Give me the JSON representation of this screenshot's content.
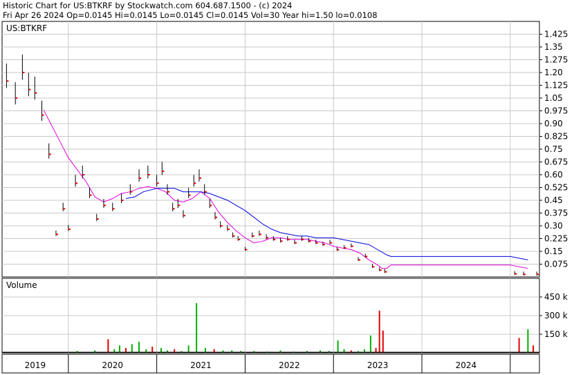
{
  "header": {
    "line1": "Historic Chart for US:BTKRF by Stockwatch.com 604.687.1500 - (c) 2024",
    "line2": "Fri Apr 26 2024   Op=0.0145   Hi=0.0145   Lo=0.0145   Cl=0.0145   Vol=30   Year hi=1.50   lo=0.0108"
  },
  "chart_data": [
    {
      "type": "line",
      "panel_label": "US:BTKRF",
      "ylim": [
        0,
        1.5
      ],
      "y_ticks": [
        0.075,
        0.15,
        0.225,
        0.3,
        0.375,
        0.45,
        0.525,
        0.6,
        0.675,
        0.75,
        0.825,
        0.9,
        0.975,
        1.05,
        1.125,
        1.2,
        1.275,
        1.35,
        1.425
      ],
      "y_tick_labels": [
        "0.075",
        "0.15",
        "0.225",
        "0.30",
        "0.375",
        "0.45",
        "0.525",
        "0.60",
        "0.675",
        "0.75",
        "0.825",
        "0.90",
        "0.975",
        "1.05",
        "1.125",
        "1.20",
        "1.275",
        "1.35",
        "1.425"
      ],
      "x_ticks": [
        "2019",
        "2020",
        "2021",
        "2022",
        "2023",
        "2024"
      ],
      "grid": true,
      "series": [
        {
          "kind": "price",
          "x": [
            2018.3,
            2018.4,
            2018.48,
            2018.55,
            2018.62,
            2018.7,
            2018.78,
            2018.86,
            2018.94,
            2019.0,
            2019.08,
            2019.16,
            2019.24,
            2019.32,
            2019.4,
            2019.5,
            2019.6,
            2019.7,
            2019.8,
            2019.9,
            2020.0,
            2020.06,
            2020.12,
            2020.18,
            2020.24,
            2020.3,
            2020.36,
            2020.42,
            2020.48,
            2020.54,
            2020.6,
            2020.66,
            2020.72,
            2020.8,
            2020.86,
            2020.92,
            2021.0,
            2021.08,
            2021.16,
            2021.24,
            2021.32,
            2021.4,
            2021.48,
            2021.56,
            2021.64,
            2021.72,
            2021.8,
            2021.88,
            2021.96,
            2022.04,
            2022.12,
            2022.2,
            2022.28,
            2022.36,
            2022.44,
            2022.52,
            2022.58,
            2024.05,
            2024.15,
            2024.3
          ],
          "values": [
            1.15,
            1.05,
            1.2,
            1.1,
            1.08,
            0.95,
            0.72,
            0.25,
            0.4,
            0.28,
            0.55,
            0.6,
            0.48,
            0.34,
            0.42,
            0.4,
            0.45,
            0.5,
            0.58,
            0.6,
            0.55,
            0.62,
            0.5,
            0.4,
            0.42,
            0.36,
            0.48,
            0.55,
            0.58,
            0.5,
            0.42,
            0.35,
            0.3,
            0.28,
            0.24,
            0.22,
            0.16,
            0.24,
            0.25,
            0.23,
            0.22,
            0.21,
            0.22,
            0.2,
            0.22,
            0.21,
            0.2,
            0.19,
            0.2,
            0.16,
            0.17,
            0.18,
            0.1,
            0.12,
            0.06,
            0.04,
            0.03,
            0.018,
            0.015,
            0.0145
          ]
        },
        {
          "kind": "moving-average-short",
          "color": "#e000e0",
          "x": [
            2018.72,
            2018.8,
            2018.9,
            2019.0,
            2019.1,
            2019.2,
            2019.3,
            2019.4,
            2019.5,
            2019.6,
            2019.7,
            2019.8,
            2019.9,
            2020.0,
            2020.1,
            2020.2,
            2020.3,
            2020.4,
            2020.5,
            2020.6,
            2020.7,
            2020.8,
            2020.9,
            2021.0,
            2021.1,
            2021.2,
            2021.3,
            2021.4,
            2021.5,
            2021.6,
            2021.7,
            2021.8,
            2021.9,
            2022.0,
            2022.1,
            2022.2,
            2022.3,
            2022.4,
            2022.5,
            2022.55,
            2022.6,
            2022.65,
            2022.75,
            2023.0,
            2023.5,
            2024.0,
            2024.2
          ],
          "values": [
            0.98,
            0.9,
            0.8,
            0.7,
            0.63,
            0.56,
            0.47,
            0.44,
            0.46,
            0.49,
            0.5,
            0.52,
            0.53,
            0.52,
            0.5,
            0.45,
            0.44,
            0.46,
            0.5,
            0.46,
            0.38,
            0.32,
            0.27,
            0.23,
            0.2,
            0.21,
            0.23,
            0.23,
            0.22,
            0.22,
            0.22,
            0.21,
            0.2,
            0.18,
            0.17,
            0.16,
            0.14,
            0.1,
            0.07,
            0.05,
            0.05,
            0.07,
            0.07,
            0.07,
            0.07,
            0.07,
            0.05
          ]
        },
        {
          "kind": "moving-average-long",
          "color": "#0000e0",
          "x": [
            2019.65,
            2019.75,
            2019.85,
            2020.0,
            2020.1,
            2020.2,
            2020.3,
            2020.4,
            2020.5,
            2020.6,
            2020.7,
            2020.8,
            2020.9,
            2021.0,
            2021.1,
            2021.2,
            2021.3,
            2021.4,
            2021.5,
            2021.6,
            2021.7,
            2021.8,
            2021.9,
            2022.0,
            2022.1,
            2022.2,
            2022.3,
            2022.4,
            2022.5,
            2022.6,
            2022.65,
            2023.0,
            2023.5,
            2024.0,
            2024.2
          ],
          "values": [
            0.46,
            0.47,
            0.5,
            0.52,
            0.52,
            0.52,
            0.5,
            0.5,
            0.5,
            0.49,
            0.47,
            0.45,
            0.42,
            0.39,
            0.35,
            0.31,
            0.28,
            0.26,
            0.25,
            0.24,
            0.24,
            0.23,
            0.23,
            0.23,
            0.22,
            0.21,
            0.2,
            0.19,
            0.16,
            0.13,
            0.12,
            0.12,
            0.12,
            0.12,
            0.1
          ]
        }
      ]
    },
    {
      "type": "bar",
      "panel_label": "Volume",
      "ylim": [
        0,
        600000
      ],
      "y_ticks": [
        150000,
        300000,
        450000
      ],
      "y_tick_labels": [
        "150 k",
        "300 k",
        "450 k"
      ],
      "series": [
        {
          "name": "",
          "x": [
            2019.1,
            2019.3,
            2019.45,
            2019.52,
            2019.58,
            2019.65,
            2019.72,
            2019.8,
            2019.88,
            2019.95,
            2020.05,
            2020.12,
            2020.2,
            2020.28,
            2020.36,
            2020.45,
            2020.55,
            2020.65,
            2020.75,
            2020.85,
            2020.95,
            2021.1,
            2021.25,
            2021.4,
            2021.55,
            2021.7,
            2021.85,
            2021.95,
            2022.05,
            2022.12,
            2022.2,
            2022.28,
            2022.35,
            2022.42,
            2022.48,
            2022.52,
            2022.56,
            2024.1,
            2024.2,
            2024.26
          ],
          "values": [
            15000,
            20000,
            110000,
            30000,
            60000,
            40000,
            70000,
            90000,
            30000,
            50000,
            40000,
            20000,
            30000,
            15000,
            60000,
            400000,
            40000,
            30000,
            20000,
            20000,
            15000,
            15000,
            10000,
            20000,
            10000,
            15000,
            20000,
            15000,
            100000,
            30000,
            20000,
            15000,
            30000,
            140000,
            40000,
            340000,
            180000,
            120000,
            190000,
            60000
          ],
          "colors": [
            "green",
            "green",
            "red",
            "green",
            "green",
            "red",
            "green",
            "green",
            "green",
            "red",
            "green",
            "green",
            "red",
            "green",
            "green",
            "green",
            "green",
            "red",
            "green",
            "green",
            "green",
            "green",
            "green",
            "green",
            "green",
            "green",
            "green",
            "green",
            "green",
            "green",
            "red",
            "green",
            "green",
            "green",
            "red",
            "red",
            "red",
            "red",
            "green",
            "red"
          ]
        }
      ]
    }
  ]
}
